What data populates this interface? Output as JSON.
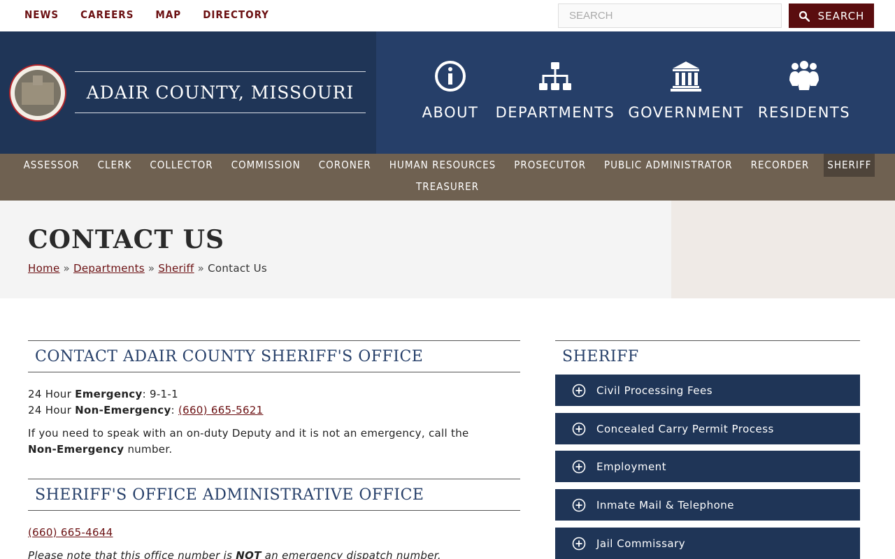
{
  "topbar": {
    "links": [
      "NEWS",
      "CAREERS",
      "MAP",
      "DIRECTORY"
    ],
    "search_placeholder": "SEARCH",
    "search_button": "SEARCH"
  },
  "header": {
    "county_title": "ADAIR COUNTY, MISSOURI",
    "nav": [
      "ABOUT",
      "DEPARTMENTS",
      "GOVERNMENT",
      "RESIDENTS"
    ]
  },
  "officenav": {
    "row1": [
      "ASSESSOR",
      "CLERK",
      "COLLECTOR",
      "COMMISSION",
      "CORONER",
      "HUMAN RESOURCES",
      "PROSECUTOR",
      "PUBLIC ADMINISTRATOR",
      "RECORDER",
      "SHERIFF"
    ],
    "row2": [
      "TREASURER"
    ]
  },
  "page": {
    "title": "CONTACT US",
    "breadcrumb": [
      "Home",
      "Departments",
      "Sheriff"
    ],
    "breadcrumb_current": "Contact Us",
    "breadcrumb_sep": "»"
  },
  "content": {
    "section1_title": "CONTACT ADAIR COUNTY SHERIFF'S OFFICE",
    "line1_prefix": "24 Hour ",
    "line1_bold": "Emergency",
    "line1_value": ": 9-1-1",
    "line2_prefix": "24 Hour ",
    "line2_bold": "Non-Emergency",
    "line2_colon": ": ",
    "line2_phone": "(660) 665-5621",
    "para_text": "If you need to speak with an on-duty Deputy and it is not an emergency, call the ",
    "para_bold": "Non-Emergency",
    "para_end": " number.",
    "section2_title": "SHERIFF'S OFFICE ADMINISTRATIVE OFFICE",
    "admin_phone": "(660) 665-4644",
    "note_prefix": "Please note that this office number is ",
    "note_bold": "NOT",
    "note_end": " an emergency dispatch number."
  },
  "sidebar": {
    "title": "SHERIFF",
    "items": [
      "Civil Processing Fees",
      "Concealed Carry Permit Process",
      "Employment",
      "Inmate Mail & Telephone",
      "Jail Commissary"
    ]
  },
  "colors": {
    "maroon": "#6b1012",
    "navy": "#1f3557",
    "blue": "#263f69",
    "brown": "#6f6151"
  }
}
